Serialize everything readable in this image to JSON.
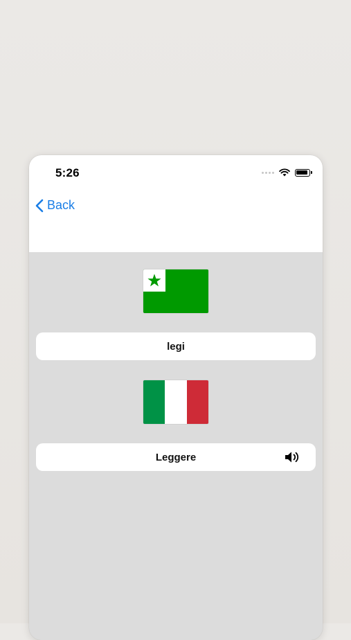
{
  "status_bar": {
    "time": "5:26",
    "signal_icon": "signal-dots-icon",
    "wifi_icon": "wifi-icon",
    "battery_icon": "battery-icon"
  },
  "nav": {
    "back_label": "Back",
    "back_icon": "chevron-left-icon"
  },
  "cards": [
    {
      "flag": "esperanto-flag",
      "flag_colors": {
        "field": "#009a00",
        "canton": "#ffffff",
        "star": "#009a00"
      },
      "word": "legi"
    },
    {
      "flag": "italy-flag",
      "flag_colors": {
        "left": "#009246",
        "middle": "#ffffff",
        "right": "#ce2b37"
      },
      "word": "Leggere",
      "action_icon": "speaker-icon"
    }
  ],
  "colors": {
    "accent": "#1a7ee6",
    "content_bg": "#dcdcdc",
    "header_bg": "#ffffff"
  }
}
